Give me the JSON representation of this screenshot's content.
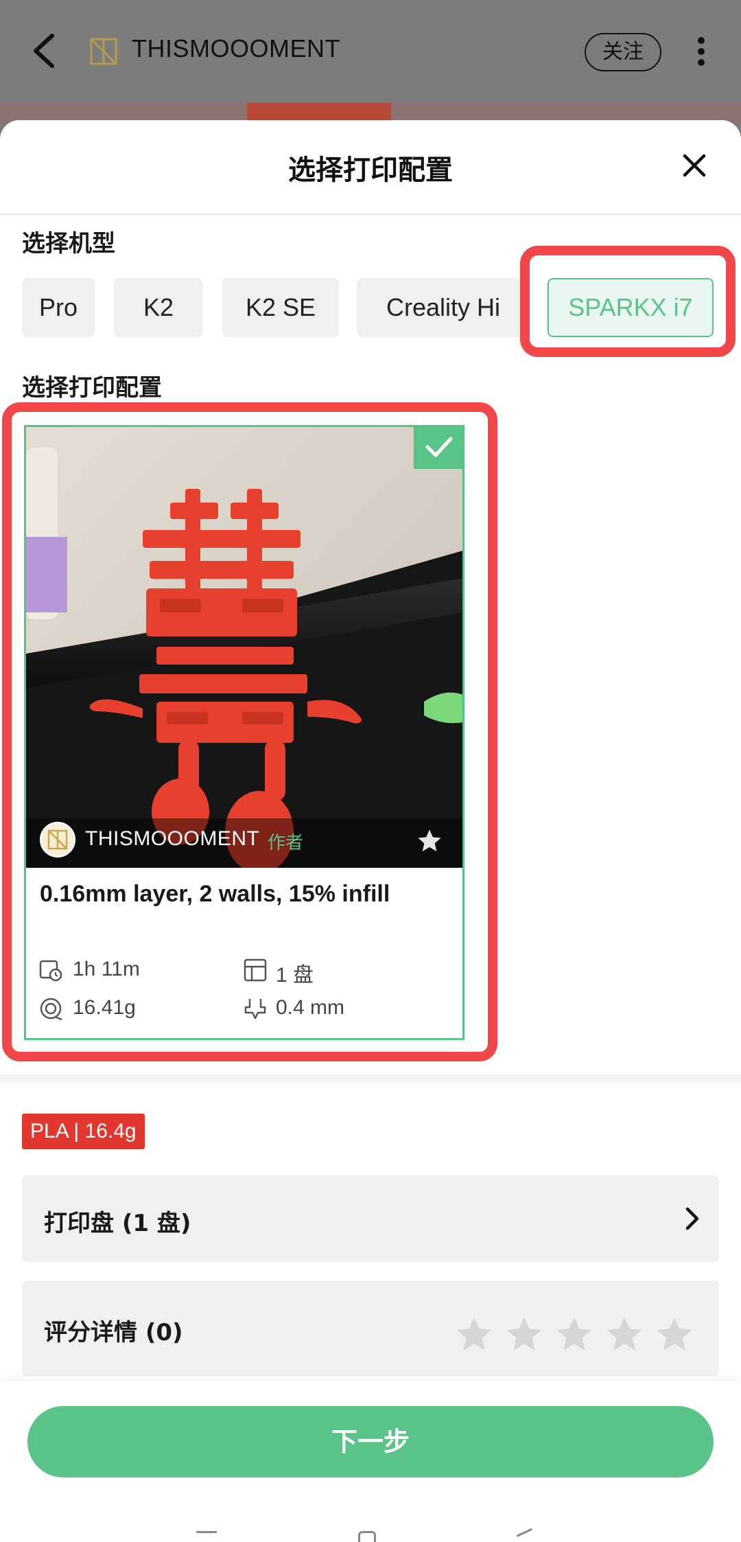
{
  "top_bar": {
    "brand_name": "THISMOOOMENT",
    "follow_label": "关注",
    "icons": {
      "back": "back-arrow-icon",
      "logo": "brand-logo-icon",
      "more": "more-vert-icon"
    }
  },
  "sheet": {
    "title": "选择打印配置",
    "close_icon": "close-icon",
    "machine_section_label": "选择机型",
    "machines": [
      {
        "label": "Pro",
        "selected": false
      },
      {
        "label": "K2",
        "selected": false
      },
      {
        "label": "K2 SE",
        "selected": false
      },
      {
        "label": "Creality Hi",
        "selected": false
      },
      {
        "label": "SPARKX i7",
        "selected": true
      }
    ],
    "config_section_label": "选择打印配置",
    "config_card": {
      "selected": true,
      "author": "THISMOOOMENT",
      "author_tag": "作者",
      "title": "0.16mm layer, 2 walls, 15% infill",
      "stats": {
        "time": "1h 11m",
        "plates": "1 盘",
        "weight": "16.41g",
        "nozzle": "0.4 mm"
      }
    },
    "material_badge": "PLA | 16.4g",
    "plates_row_label": "打印盘 (1 盘)",
    "rating_row_label": "评分详情 (0)",
    "rating": {
      "value": 0,
      "max": 5
    },
    "next_button": "下一步"
  },
  "colors": {
    "accent_green": "#5ac389",
    "highlight_red": "#f04848",
    "material_red": "#e2372f"
  }
}
